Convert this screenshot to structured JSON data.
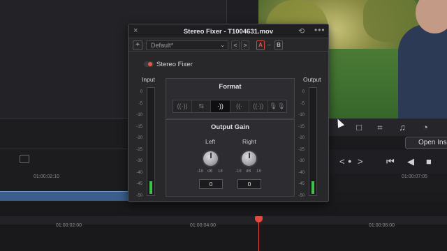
{
  "plugin": {
    "title": "Stereo Fixer - T1004631.mov",
    "close_icon": "×",
    "reset_icon": "⟲",
    "more_icon": "•••",
    "add_label": "+",
    "preset_value": "Default*",
    "preset_dropdown": "⌄",
    "prev_label": "<",
    "next_label": ">",
    "compare_a": "A",
    "compare_arrow": "→",
    "compare_b": "B",
    "enable_label": "Stereo Fixer",
    "input_label": "Input",
    "output_label": "Output",
    "meter_scale": [
      "0",
      "-5",
      "-10",
      "-15",
      "-20",
      "-25",
      "-30",
      "-40",
      "-45",
      "-50"
    ],
    "input_level_fraction": 0.12,
    "output_level_fraction": 0.12,
    "format": {
      "title": "Format",
      "buttons": [
        {
          "glyph": "((·))",
          "name": "stereo"
        },
        {
          "glyph": "⇆",
          "name": "swap"
        },
        {
          "glyph": "·))",
          "name": "right-to-both"
        },
        {
          "glyph": "((·",
          "name": "left-to-both"
        },
        {
          "glyph": "((·))",
          "name": "mono"
        },
        {
          "glyph": "🎙🎙",
          "name": "dual-mono"
        }
      ],
      "active_index": 2
    },
    "output_gain": {
      "title": "Output Gain",
      "left_label": "Left",
      "right_label": "Right",
      "scale_min": "-18",
      "scale_unit": "dB",
      "scale_max": "18",
      "left_value": "0",
      "right_value": "0"
    }
  },
  "background": {
    "timecodes_ruler": [
      "01:00:02:10",
      "01:00:07:05"
    ],
    "timecodes_lower": [
      "01:00:02:00",
      "01:00:04:00",
      "01:00:06:00"
    ],
    "open_inspector": "Open Insp",
    "toolbar_icons": [
      "□",
      "⌗",
      "♫",
      "◔"
    ],
    "transport": [
      "<",
      "●",
      ">",
      "⏮",
      "◀",
      "■"
    ]
  }
}
